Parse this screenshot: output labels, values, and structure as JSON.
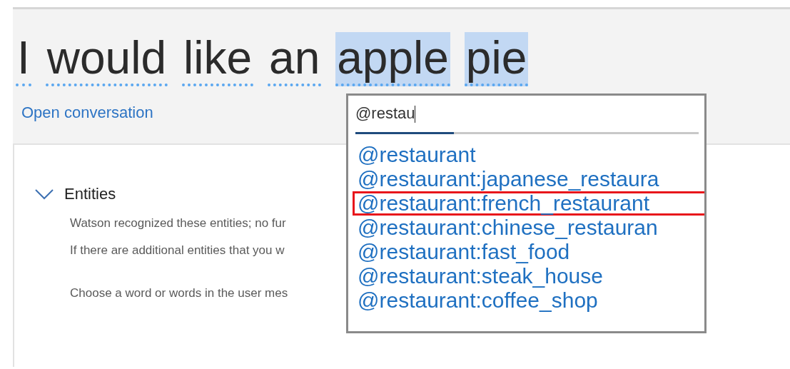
{
  "utterance": {
    "words": [
      {
        "text": "I",
        "selected": false
      },
      {
        "text": "would",
        "selected": false
      },
      {
        "text": "like",
        "selected": false
      },
      {
        "text": "an",
        "selected": false
      },
      {
        "text": "apple",
        "selected": true
      },
      {
        "text": "pie",
        "selected": true
      }
    ]
  },
  "open_conversation_link": "Open conversation",
  "entities_section": {
    "title": "Entities",
    "expanded": true,
    "paragraphs": [
      "Watson recognized these entities; no fur",
      "If there are additional entities that you w",
      "Choose a word or words in the user mes"
    ]
  },
  "entity_dropdown": {
    "search": {
      "value": "@restau"
    },
    "options": [
      {
        "label": "@restaurant",
        "highlighted": false
      },
      {
        "label": "@restaurant:japanese_restaura",
        "highlighted": false
      },
      {
        "label": "@restaurant:french_restaurant",
        "highlighted": true
      },
      {
        "label": "@restaurant:chinese_restauran",
        "highlighted": false
      },
      {
        "label": "@restaurant:fast_food",
        "highlighted": false
      },
      {
        "label": "@restaurant:steak_house",
        "highlighted": false
      },
      {
        "label": "@restaurant:coffee_shop",
        "highlighted": false
      }
    ]
  }
}
